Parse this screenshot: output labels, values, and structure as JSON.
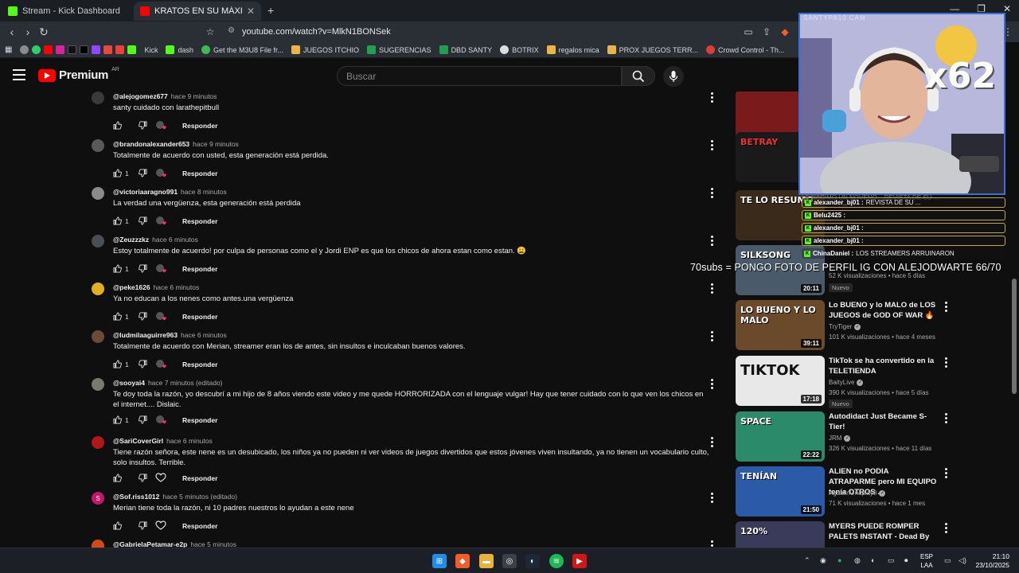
{
  "browser": {
    "tabs": [
      {
        "title": "Stream - Kick Dashboard",
        "active": false
      },
      {
        "title": "KRATOS EN SU MÁXIMO EXPLENDOR",
        "active": true
      }
    ],
    "url": "youtube.com/watch?v=MlkN1BONSek"
  },
  "bookmarks": [
    "Kick",
    "dash",
    "Get the M3U8 File fr...",
    "JUEGOS ITCHIO",
    "SUGERENCIAS",
    "DBD SANTY",
    "BOTRIX",
    "regalos mica",
    "PROX JUEGOS TERR...",
    "Crowd Control - Th..."
  ],
  "youtube": {
    "logo_text": "Premium",
    "country": "AR",
    "search_placeholder": "Buscar"
  },
  "comments": [
    {
      "user": "@alejogomez677",
      "time": "hace 9 minutos",
      "text": "santy cuidado con larathepitbull",
      "likes": "",
      "avatar_color": "#3a3a3a"
    },
    {
      "user": "@brandonalexander653",
      "time": "hace 9 minutos",
      "text": "Totalmente de acuerdo con usted, esta generación está perdida.",
      "likes": "1",
      "avatar_color": "#5a5a5a"
    },
    {
      "user": "@victoriaaragno991",
      "time": "hace 8 minutos",
      "text": "La verdad una vergüenza, esta generación está perdida",
      "likes": "1",
      "avatar_color": "#8a8a8a"
    },
    {
      "user": "@Zeuzzzkz",
      "time": "hace 6 minutos",
      "text": "Estoy totalmente de acuerdo! por culpa de personas como el y Jordi ENP es que los chicos de ahora estan como estan. 😩",
      "likes": "1",
      "avatar_color": "#4a4f55"
    },
    {
      "user": "@peke1626",
      "time": "hace 6 minutos",
      "text": "Ya no educan a los nenes como antes.una vergüenza",
      "likes": "1",
      "avatar_color": "#e0b020"
    },
    {
      "user": "@ludmilaaguirre963",
      "time": "hace 6 minutos",
      "text": "Totalmente de acuerdo con Merian, streamer eran los de antes, sin insultos e inculcaban buenos valores.",
      "likes": "1",
      "avatar_color": "#6b4a3a"
    },
    {
      "user": "@sooyai4",
      "time": "hace 7 minutos (editado)",
      "text": "Te doy toda la razón, yo descubrí a mi hijo de 8 años viendo este video y me quede HORRORIZADA con el lenguaje vulgar! Hay que tener cuidado con lo que ven los chicos en el internet.... Dislaic.",
      "likes": "1",
      "avatar_color": "#7a7a6a"
    },
    {
      "user": "@SariCoverGirl",
      "time": "hace 6 minutos",
      "text": "Tiene razón señora, este nene es un desubicado, los niños ya no pueden ni ver videos de juegos divertidos que estos jóvenes viven insultando, ya no tienen un vocabulario culto, solo insultos. Terrible.",
      "likes": "",
      "avatar_color": "#b01818"
    },
    {
      "user": "@Sof.riss1012",
      "time": "hace 5 minutos (editado)",
      "text": "Merian tiene toda la razón, ni 10 padres nuestros lo ayudan a este nene",
      "likes": "",
      "avatar_color": "#c0186a",
      "avatar_letter": "S"
    },
    {
      "user": "@GabrielaPetamar-e2p",
      "time": "hace 5 minutos",
      "text": "",
      "likes": "",
      "avatar_color": "#d04a1a"
    }
  ],
  "reply_label": "Responder",
  "recommendations": [
    {
      "title": "",
      "channel": "",
      "views": "",
      "age": "",
      "duration": "",
      "thumb_color": "#7a1a1a",
      "thumb_text": ""
    },
    {
      "title": "",
      "channel": "",
      "views": "",
      "age": "",
      "duration": "",
      "thumb_color": "#1a1a1a",
      "thumb_text": "BETRAY"
    },
    {
      "title": "",
      "channel": "",
      "views": "",
      "age": "",
      "duration": "",
      "thumb_color": "#3a2a1a",
      "thumb_text": "TE LO RESUMO"
    },
    {
      "title": "",
      "channel": "",
      "views": "52 K visualizaciones",
      "age": "hace 5 días",
      "duration": "20:11",
      "badge": "Nuevo",
      "thumb_color": "#4a5a6a",
      "thumb_text": "SILKSONG"
    },
    {
      "title": "Lo BUENO y lo MALO de LOS JUEGOS de GOD OF WAR 🔥",
      "channel": "TryTiger",
      "views": "101 K visualizaciones",
      "age": "hace 4 meses",
      "duration": "39:11",
      "thumb_color": "#6a4a2a",
      "thumb_text": "LO BUENO Y LO MALO"
    },
    {
      "title": "TikTok se ha convertido en la TELETIENDA",
      "channel": "BaityLive",
      "views": "390 K visualizaciones",
      "age": "hace 5 días",
      "duration": "17:18",
      "badge": "Nuevo",
      "thumb_color": "#e8e8e8",
      "thumb_text": "TIKTOK"
    },
    {
      "title": "Autodidact Just Became S-Tier!",
      "channel": "JRM",
      "views": "326 K visualizaciones",
      "age": "hace 11 días",
      "duration": "22:22",
      "thumb_color": "#2a8a6a",
      "thumb_text": "SPACE"
    },
    {
      "title": "ALIEN no PODIA ATRAPARME pero MI EQUIPO tenía OTROS ...",
      "channel": "AgustinUnaplay8",
      "views": "71 K visualizaciones",
      "age": "hace 1 mes",
      "duration": "21:50",
      "thumb_color": "#2a5aa8",
      "thumb_text": "TENÍAN"
    },
    {
      "title": "MYERS PUEDE ROMPER PALETS INSTANT - Dead By ...",
      "channel": "",
      "views": "",
      "age": "",
      "duration": "",
      "thumb_color": "#3a3a5a",
      "thumb_text": "120%"
    }
  ],
  "overlay": {
    "cam_label": "SANTYPA10 CAM",
    "multiplier": "x62",
    "goal_text": "70subs = PONGO FOTO DE PERFIL IG CON ALEJODWARTE   66/70",
    "chat_title": "LE NACIMO UN NOVENO... REVISTA DE SU ...",
    "chat": [
      {
        "user": "alexander_bj01 :",
        "msg": "REVISTA DE SU ..."
      },
      {
        "user": "Belu2425 :",
        "msg": ""
      },
      {
        "user": "alexander_bj01 :",
        "msg": ""
      },
      {
        "user": "alexander_bj01 :",
        "msg": ""
      },
      {
        "user": "ChinaDaniel :",
        "msg": "LOS STREAMERS ARRUINARON"
      }
    ]
  },
  "taskbar": {
    "language": "ESP",
    "layout": "LAA",
    "time": "21:10",
    "date": "23/10/2025"
  }
}
